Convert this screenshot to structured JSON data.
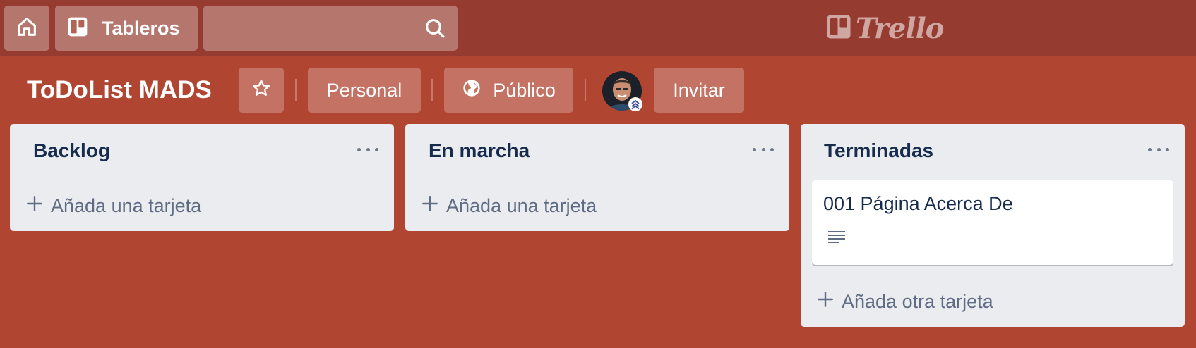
{
  "topbar": {
    "home_icon": "home-icon",
    "boards_icon": "boards-icon",
    "boards_label": "Tableros",
    "search": {
      "value": "",
      "placeholder": "",
      "icon": "search-icon"
    },
    "logo_text": "Trello"
  },
  "board": {
    "title": "ToDoList MADS",
    "star_icon": "star-icon",
    "team_label": "Personal",
    "visibility_icon": "globe-icon",
    "visibility_label": "Público",
    "invite_label": "Invitar"
  },
  "lists": [
    {
      "title": "Backlog",
      "cards": [],
      "add_label": "Añada una tarjeta"
    },
    {
      "title": "En marcha",
      "cards": [],
      "add_label": "Añada una tarjeta"
    },
    {
      "title": "Terminadas",
      "cards": [
        {
          "title": "001 Página Acerca De",
          "badge_icon": "description-icon"
        }
      ],
      "add_label": "Añada otra tarjeta"
    }
  ],
  "colors": {
    "board_background": "#b04632",
    "topbar_background": "#963b2f",
    "list_background": "#ebecf0",
    "text_primary": "#172b4d",
    "text_muted": "#5e6c84"
  }
}
